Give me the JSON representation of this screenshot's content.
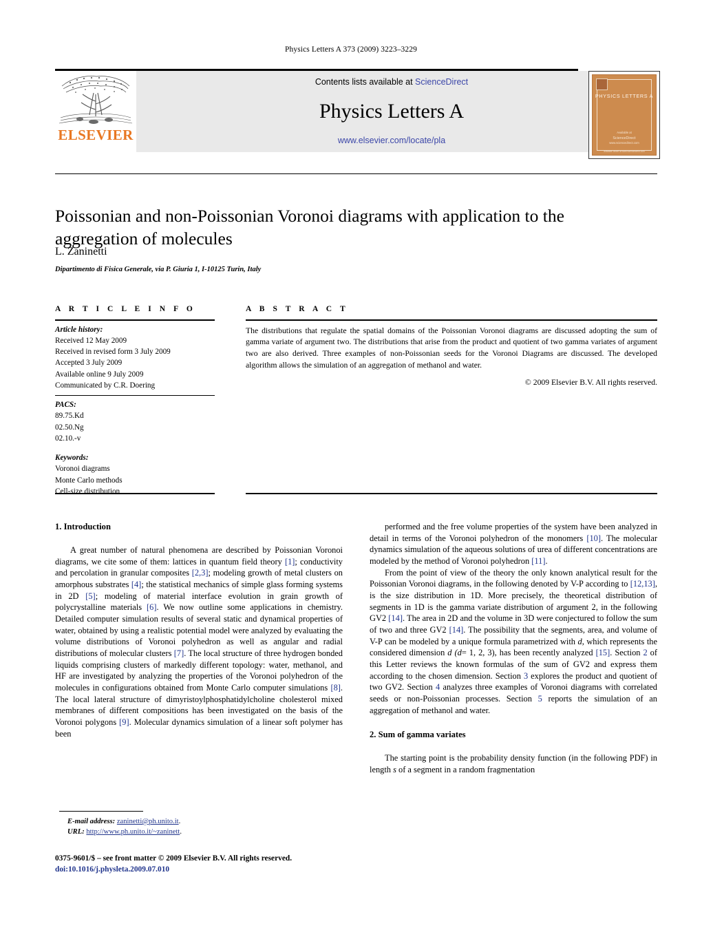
{
  "running_head": "Physics Letters A 373 (2009) 3223–3229",
  "masthead": {
    "contents_prefix": "Contents lists available at ",
    "sciencedirect": "ScienceDirect",
    "journal_name": "Physics Letters A",
    "journal_url": "www.elsevier.com/locate/pla",
    "publisher": "ELSEVIER",
    "link_color": "#3b46a8",
    "elsevier_orange": "#E87722",
    "cover": {
      "title": "PHYSICS LETTERS A",
      "footer_line1": "Available at",
      "footer_line2": "ScienceDirect",
      "footer_line3": "www.sciencedirect.com",
      "bottom_bar": "available online at www.sciencedirect.com",
      "background": "#cd8b4e"
    }
  },
  "article": {
    "title": "Poissonian and non-Poissonian Voronoi diagrams with application to the aggregation of molecules",
    "author": "L. Zaninetti",
    "affiliation": "Dipartimento di Fisica Generale, via P. Giuria 1, I-10125 Turin, Italy"
  },
  "info": {
    "heading": "A R T I C L E   I N F O",
    "history_label": "Article history:",
    "history": [
      "Received 12 May 2009",
      "Received in revised form 3 July 2009",
      "Accepted 3 July 2009",
      "Available online 9 July 2009",
      "Communicated by C.R. Doering"
    ],
    "pacs_label": "PACS:",
    "pacs": [
      "89.75.Kd",
      "02.50.Ng",
      "02.10.-v"
    ],
    "keywords_label": "Keywords:",
    "keywords": [
      "Voronoi diagrams",
      "Monte Carlo methods",
      "Cell-size distribution"
    ]
  },
  "abstract": {
    "heading": "A B S T R A C T",
    "text": "The distributions that regulate the spatial domains of the Poissonian Voronoi diagrams are discussed adopting the sum of gamma variate of argument two. The distributions that arise from the product and quotient of two gamma variates of argument two are also derived. Three examples of non-Poissonian seeds for the Voronoi Diagrams are discussed. The developed algorithm allows the simulation of an aggregation of methanol and water.",
    "copyright": "© 2009 Elsevier B.V. All rights reserved."
  },
  "sections": {
    "intro_heading": "1. Introduction",
    "sum_heading": "2. Sum of gamma variates"
  },
  "body": {
    "left_p1_a": "A great number of natural phenomena are described by Poissonian Voronoi diagrams, we cite some of them: lattices in quantum field theory ",
    "ref1": "[1]",
    "left_p1_b": "; conductivity and percolation in granular composites ",
    "ref23": "[2,3]",
    "left_p1_c": "; modeling growth of metal clusters on amorphous substrates ",
    "ref4": "[4]",
    "left_p1_d": "; the statistical mechanics of simple glass forming systems in 2D ",
    "ref5": "[5]",
    "left_p1_e": "; modeling of material interface evolution in grain growth of polycrystalline materials ",
    "ref6": "[6]",
    "left_p1_f": ". We now outline some applications in chemistry. Detailed computer simulation results of several static and dynamical properties of water, obtained by using a realistic potential model were analyzed by evaluating the volume distributions of Voronoi polyhedron as well as angular and radial distributions of molecular clusters ",
    "ref7": "[7]",
    "left_p1_g": ". The local structure of three hydrogen bonded liquids comprising clusters of markedly different topology: water, methanol, and HF are investigated by analyzing the properties of the Voronoi polyhedron of the molecules in configurations obtained from Monte Carlo computer simulations ",
    "ref8": "[8]",
    "left_p1_h": ". The local lateral structure of dimyristoylphosphatidylcholine cholesterol mixed membranes of different compositions has been investigated on the basis of the Voronoi polygons ",
    "ref9": "[9]",
    "left_p1_i": ". Molecular dynamics simulation of a linear soft polymer has been",
    "right_p1_a": "performed and the free volume properties of the system have been analyzed in detail in terms of the Voronoi polyhedron of the monomers ",
    "ref10": "[10]",
    "right_p1_b": ". The molecular dynamics simulation of the aqueous solutions of urea of different concentrations are modeled by the method of Voronoi polyhedron ",
    "ref11": "[11]",
    "right_p1_c": ".",
    "right_p2_a": "From the point of view of the theory the only known analytical result for the Poissonian Voronoi diagrams, in the following denoted by V-P according to ",
    "ref1213": "[12,13]",
    "right_p2_b": ", is the size distribution in 1D. More precisely, the theoretical distribution of segments in 1D is the gamma variate distribution of argument 2, in the following GV2 ",
    "ref14": "[14]",
    "right_p2_c": ". The area in 2D and the volume in 3D were conjectured to follow the sum of two and three GV2 ",
    "ref14b": "[14]",
    "right_p2_d": ". The possibility that the segments, area, and volume of V-P can be modeled by a unique formula parametrized with ",
    "var_d1": "d",
    "right_p2_e": ", which represents the considered dimension ",
    "var_d2": "d",
    "var_d3": "(d",
    "right_p2_f": "= 1, 2, 3), has been recently analyzed ",
    "ref15": "[15]",
    "right_p2_g": ". Section ",
    "secref2": "2",
    "right_p2_h": " of this Letter reviews the known formulas of the sum of GV2 and express them according to the chosen dimension. Section ",
    "secref3": "3",
    "right_p2_i": " explores the product and quotient of two GV2. Section ",
    "secref4": "4",
    "right_p2_j": " analyzes three examples of Voronoi diagrams with correlated seeds or non-Poissonian processes. Section ",
    "secref5": "5",
    "right_p2_k": " reports the simulation of an aggregation of methanol and water.",
    "right_p3_a": "The starting point is the probability density function (in the following PDF) in length ",
    "var_s": "s",
    "right_p3_b": " of a segment in a random fragmentation"
  },
  "footnotes": {
    "email_label": "E-mail address:",
    "email": "zaninetti@ph.unito.it",
    "email_suffix": ".",
    "url_label": "URL:",
    "url": "http://www.ph.unito.it/~zaninett",
    "url_suffix": "."
  },
  "imprint": {
    "line1_a": "0375-9601/$ – see front matter ",
    "line1_b": "© 2009 Elsevier B.V. All rights reserved.",
    "doi": "doi:10.1016/j.physleta.2009.07.010"
  }
}
